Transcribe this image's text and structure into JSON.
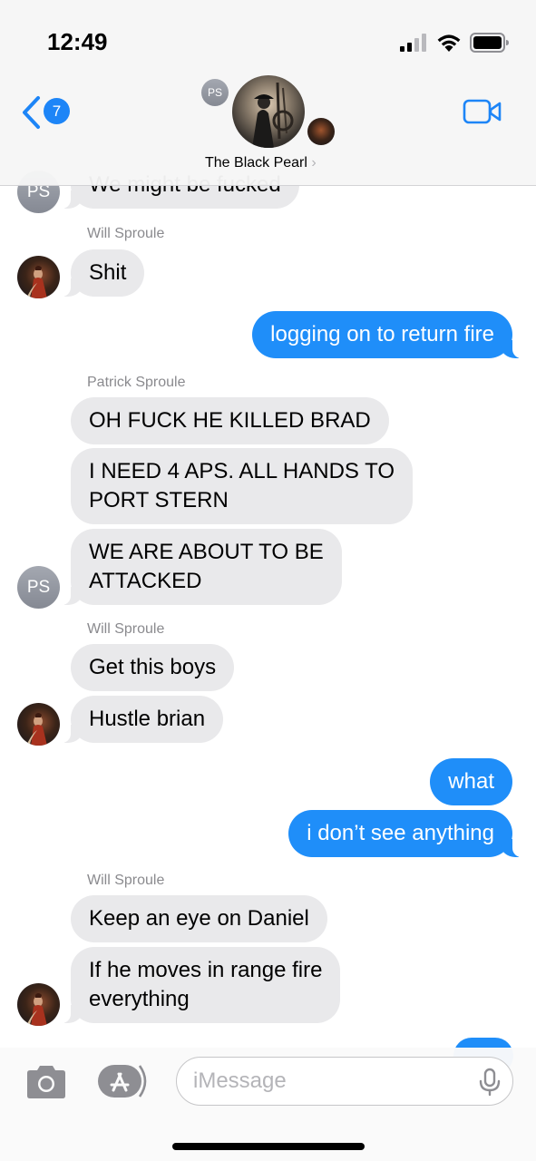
{
  "status_bar": {
    "time": "12:49"
  },
  "header": {
    "back_badge_count": "7",
    "group_name": "The Black Pearl",
    "group_avatars": {
      "initials": "PS"
    }
  },
  "messages": [
    {
      "direction": "in",
      "text": "We might be fucked",
      "avatar": "PS"
    },
    {
      "sender": "Will Sproule"
    },
    {
      "direction": "in",
      "text": "Shit",
      "avatar": "photo"
    },
    {
      "direction": "out",
      "text": "logging on to return fire"
    },
    {
      "sender": "Patrick Sproule"
    },
    {
      "direction": "in",
      "text": "OH FUCK HE KILLED BRAD"
    },
    {
      "direction": "in",
      "lines": [
        "I NEED 4 APS. ALL HANDS TO",
        "PORT STERN"
      ]
    },
    {
      "direction": "in",
      "lines": [
        "WE ARE ABOUT TO BE",
        "ATTACKED"
      ],
      "avatar": "PS"
    },
    {
      "sender": "Will Sproule"
    },
    {
      "direction": "in",
      "text": "Get this boys"
    },
    {
      "direction": "in",
      "text": "Hustle brian",
      "avatar": "photo"
    },
    {
      "direction": "out",
      "text": "what"
    },
    {
      "direction": "out",
      "text": "i don’t see anything"
    },
    {
      "sender": "Will Sproule"
    },
    {
      "direction": "in",
      "text": "Keep an eye on Daniel"
    },
    {
      "direction": "in",
      "lines": [
        "If he moves in range fire",
        "everything"
      ],
      "avatar": "photo"
    }
  ],
  "input_bar": {
    "placeholder": "iMessage"
  },
  "icons": [
    "signal-icon",
    "wifi-icon",
    "battery-icon",
    "chevron-left-icon",
    "chevron-right-icon",
    "video-camera-icon",
    "camera-icon",
    "app-store-icon",
    "microphone-icon"
  ],
  "colors": {
    "accent": "#1f8ef9",
    "incoming_bubble": "#e9e9eb",
    "badge": "#1d85f7"
  }
}
